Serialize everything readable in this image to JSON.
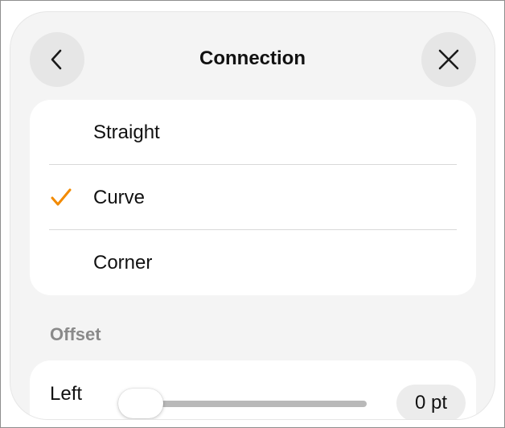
{
  "header": {
    "title": "Connection",
    "back_icon": "chevron-left-icon",
    "close_icon": "close-icon"
  },
  "connection_options": [
    {
      "label": "Straight",
      "selected": false
    },
    {
      "label": "Curve",
      "selected": true
    },
    {
      "label": "Corner",
      "selected": false
    }
  ],
  "offset": {
    "section_title": "Offset",
    "row_label": "Left",
    "value": "0 pt",
    "slider_fraction": 0.0
  },
  "colors": {
    "accent_check": "#f28a00"
  }
}
